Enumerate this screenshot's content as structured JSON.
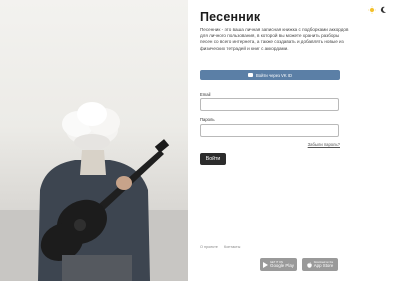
{
  "app": {
    "title": "Песенник",
    "description": "Песенник - это ваша личная записная книжка с подборками аккордов для личного пользования, в которой вы можете хранить разборы песен со всего интернета, а также создавать и добавлять новые из физических тетрадей и книг с аккордами."
  },
  "theme": {
    "light_icon": "sun-icon",
    "dark_icon": "moon-icon",
    "active": "light"
  },
  "vk_login": {
    "label": "Войти через VK ID",
    "icon": "vk-icon"
  },
  "form": {
    "email_label": "Email",
    "email_value": "",
    "password_label": "Пароль",
    "password_value": "",
    "forgot_label": "Забыли пароль?",
    "submit_label": "Войти"
  },
  "footer": {
    "about": "О проекте",
    "contacts": "Контакты"
  },
  "stores": {
    "google": {
      "small": "GET IT ON",
      "name": "Google Play",
      "icon": "google-play-icon"
    },
    "apple": {
      "small": "Download on the",
      "name": "App Store",
      "icon": "apple-icon"
    }
  },
  "colors": {
    "vk": "#5b7fa6",
    "button": "#2c2c2c",
    "store_badge": "#9a9a9a",
    "sun": "#f3c02a"
  }
}
